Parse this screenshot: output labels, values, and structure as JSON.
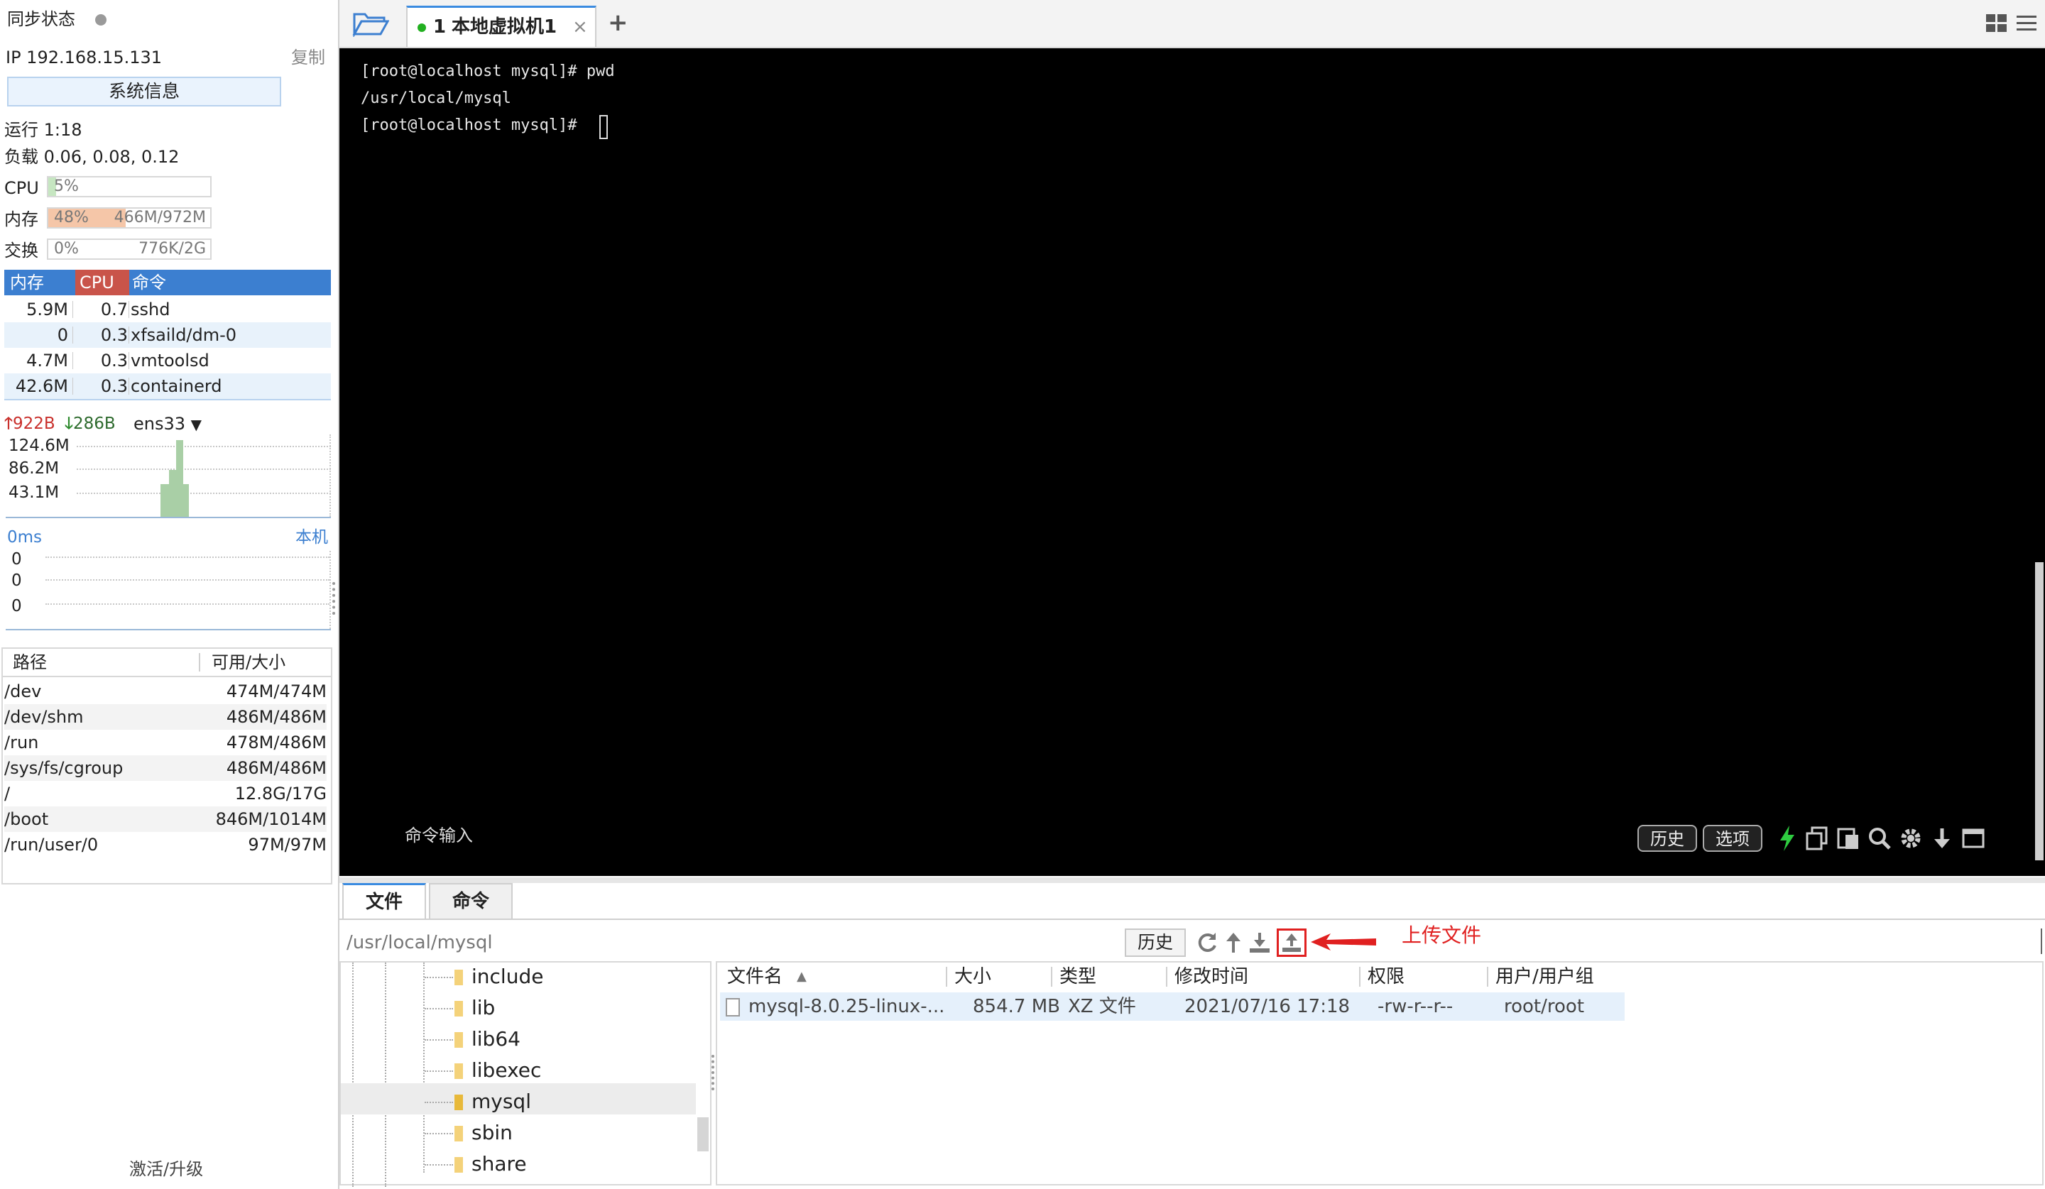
{
  "sidebar": {
    "sync_status": "同步状态",
    "ip": "IP 192.168.15.131",
    "copy": "复制",
    "sysinfo_button": "系统信息",
    "uptime": "运行 1:18",
    "load": "负载 0.06, 0.08, 0.12",
    "cpu": {
      "label": "CPU",
      "percent_text": "5%",
      "fraction": 0.05
    },
    "mem": {
      "label": "内存",
      "percent_text": "48%",
      "amount": "466M/972M",
      "fraction": 0.48
    },
    "swap": {
      "label": "交换",
      "percent_text": "0%",
      "amount": "776K/2G",
      "fraction": 0.0
    },
    "process_table": {
      "headers": {
        "mem": "内存",
        "cpu": "CPU",
        "cmd": "命令"
      },
      "rows": [
        {
          "mem": "5.9M",
          "cpu": "0.7",
          "cmd": "sshd"
        },
        {
          "mem": "0",
          "cpu": "0.3",
          "cmd": "xfsaild/dm-0"
        },
        {
          "mem": "4.7M",
          "cpu": "0.3",
          "cmd": "vmtoolsd"
        },
        {
          "mem": "42.6M",
          "cpu": "0.3",
          "cmd": "containerd"
        }
      ]
    },
    "network": {
      "up": "922B",
      "down": "286B",
      "interface": "ens33",
      "scale_labels": [
        "124.6M",
        "86.2M",
        "43.1M"
      ]
    },
    "ping": {
      "latency": "0ms",
      "target": "本机",
      "scale_labels": [
        "0",
        "0",
        "0"
      ]
    },
    "filesystem": {
      "headers": {
        "path": "路径",
        "size": "可用/大小"
      },
      "rows": [
        {
          "path": "/dev",
          "size": "474M/474M"
        },
        {
          "path": "/dev/shm",
          "size": "486M/486M"
        },
        {
          "path": "/run",
          "size": "478M/486M"
        },
        {
          "path": "/sys/fs/cgroup",
          "size": "486M/486M"
        },
        {
          "path": "/",
          "size": "12.8G/17G"
        },
        {
          "path": "/boot",
          "size": "846M/1014M"
        },
        {
          "path": "/run/user/0",
          "size": "97M/97M"
        }
      ]
    },
    "activate": "激活/升级"
  },
  "tabbar": {
    "session_tab": {
      "index": "1",
      "name": "本地虚拟机1"
    },
    "add": "+",
    "close": "×"
  },
  "terminal": {
    "lines": [
      "[root@localhost mysql]# pwd",
      "/usr/local/mysql",
      "[root@localhost mysql]# "
    ],
    "command_input": "命令输入",
    "history_button": "历史",
    "options_button": "选项"
  },
  "bottom": {
    "tabs": [
      "文件",
      "命令"
    ],
    "path": "/usr/local/mysql",
    "history_button": "历史",
    "annotation": "上传文件",
    "tree": [
      "include",
      "lib",
      "lib64",
      "libexec",
      "mysql",
      "sbin",
      "share"
    ],
    "file_columns": [
      "文件名",
      "大小",
      "类型",
      "修改时间",
      "权限",
      "用户/用户组"
    ],
    "files": [
      {
        "name": "mysql-8.0.25-linux-...",
        "size": "854.7 MB",
        "type": "XZ 文件",
        "mtime": "2021/07/16 17:18",
        "perm": "-rw-r--r--",
        "owner": "root/root"
      }
    ]
  },
  "colors": {
    "accent_blue": "#3c7fd0",
    "cpu_red": "#c9544a",
    "mem_fill": "#f5c6a8",
    "cpu_fill": "#c6e6c1",
    "annotation_red": "#e02020"
  }
}
